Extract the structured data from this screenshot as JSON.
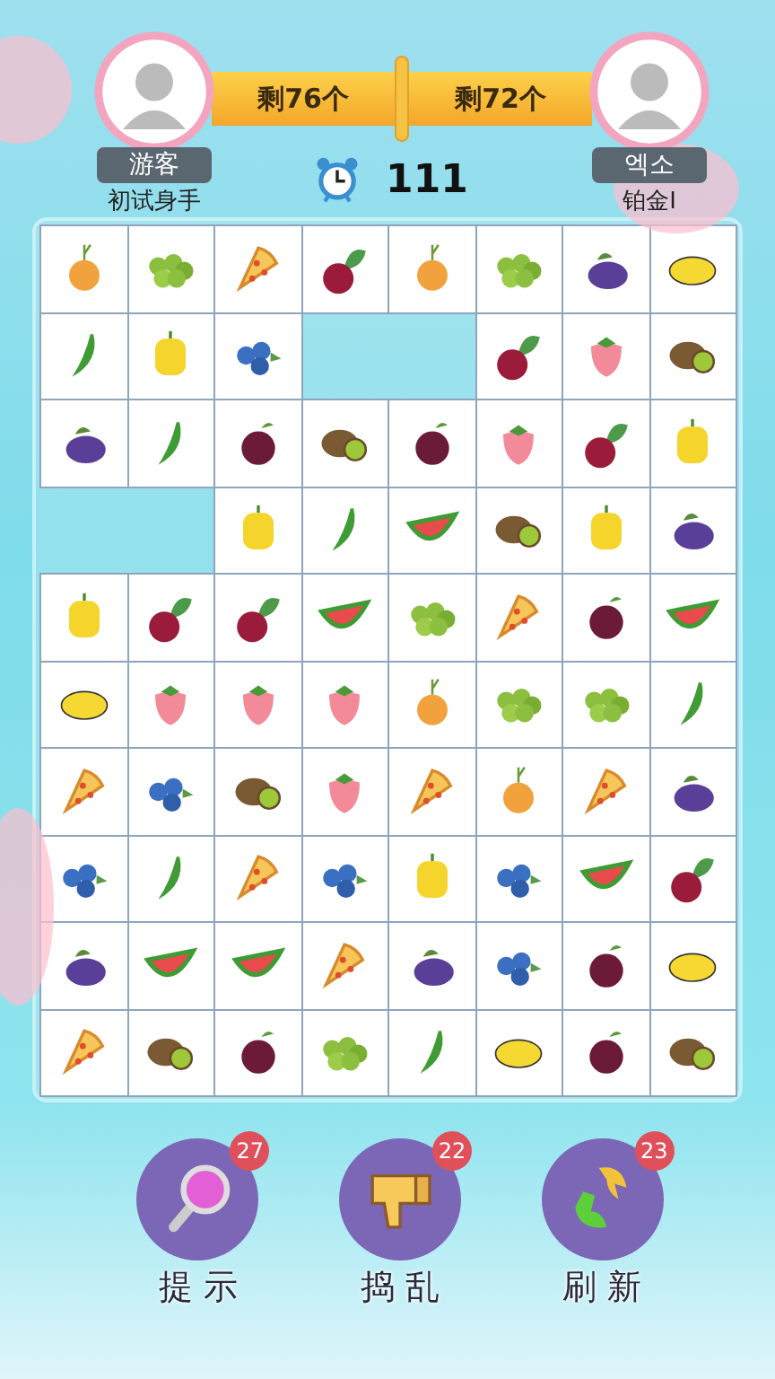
{
  "players": [
    {
      "name": "游客",
      "rank": "初试身手",
      "remaining": "剩76个"
    },
    {
      "name": "엑소",
      "rank": "铂金I",
      "remaining": "剩72个"
    }
  ],
  "timer": "111",
  "board": {
    "rows": [
      [
        {
          "kind": "onion"
        },
        {
          "kind": "grapes"
        },
        {
          "kind": "pizza"
        },
        {
          "kind": "beet"
        },
        {
          "kind": "onion"
        },
        {
          "kind": "grapes"
        },
        {
          "kind": "plum"
        },
        {
          "kind": "mango"
        }
      ],
      [
        {
          "kind": "pea"
        },
        {
          "kind": "pepper"
        },
        {
          "kind": "blueberry"
        },
        {
          "kind": "empty"
        },
        {
          "kind": "empty"
        },
        {
          "kind": "beet"
        },
        {
          "kind": "strawberry"
        },
        {
          "kind": "kiwi"
        }
      ],
      [
        {
          "kind": "plum"
        },
        {
          "kind": "pea"
        },
        {
          "kind": "cherry"
        },
        {
          "kind": "kiwi"
        },
        {
          "kind": "cherry"
        },
        {
          "kind": "strawberry"
        },
        {
          "kind": "beet"
        },
        {
          "kind": "pepper"
        }
      ],
      [
        {
          "kind": "empty"
        },
        {
          "kind": "empty"
        },
        {
          "kind": "pepper"
        },
        {
          "kind": "pea"
        },
        {
          "kind": "watermelon"
        },
        {
          "kind": "kiwi"
        },
        {
          "kind": "pepper"
        },
        {
          "kind": "plum"
        }
      ],
      [
        {
          "kind": "pepper"
        },
        {
          "kind": "beet"
        },
        {
          "kind": "beet"
        },
        {
          "kind": "watermelon"
        },
        {
          "kind": "grapes"
        },
        {
          "kind": "pizza"
        },
        {
          "kind": "cherry"
        },
        {
          "kind": "watermelon"
        }
      ],
      [
        {
          "kind": "mango"
        },
        {
          "kind": "strawberry"
        },
        {
          "kind": "strawberry"
        },
        {
          "kind": "strawberry"
        },
        {
          "kind": "onion"
        },
        {
          "kind": "grapes"
        },
        {
          "kind": "grapes"
        },
        {
          "kind": "pea"
        }
      ],
      [
        {
          "kind": "pizza"
        },
        {
          "kind": "blueberry"
        },
        {
          "kind": "kiwi"
        },
        {
          "kind": "strawberry"
        },
        {
          "kind": "pizza"
        },
        {
          "kind": "onion"
        },
        {
          "kind": "pizza"
        },
        {
          "kind": "plum"
        }
      ],
      [
        {
          "kind": "blueberry"
        },
        {
          "kind": "pea"
        },
        {
          "kind": "pizza"
        },
        {
          "kind": "blueberry"
        },
        {
          "kind": "pepper"
        },
        {
          "kind": "blueberry"
        },
        {
          "kind": "watermelon"
        },
        {
          "kind": "beet"
        }
      ],
      [
        {
          "kind": "plum"
        },
        {
          "kind": "watermelon"
        },
        {
          "kind": "watermelon"
        },
        {
          "kind": "pizza"
        },
        {
          "kind": "plum"
        },
        {
          "kind": "blueberry"
        },
        {
          "kind": "cherry"
        },
        {
          "kind": "mango"
        }
      ],
      [
        {
          "kind": "pizza"
        },
        {
          "kind": "kiwi"
        },
        {
          "kind": "cherry"
        },
        {
          "kind": "grapes"
        },
        {
          "kind": "pea"
        },
        {
          "kind": "mango"
        },
        {
          "kind": "cherry"
        },
        {
          "kind": "kiwi"
        }
      ]
    ]
  },
  "tools": [
    {
      "kind": "hint",
      "label": "提 示",
      "count": "27"
    },
    {
      "kind": "disrupt",
      "label": "捣 乱",
      "count": "22"
    },
    {
      "kind": "shuffle",
      "label": "刷 新",
      "count": "23"
    }
  ]
}
